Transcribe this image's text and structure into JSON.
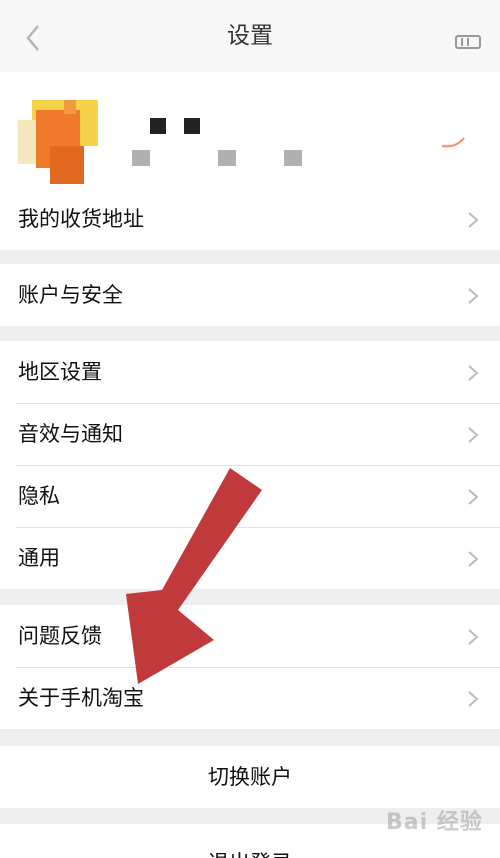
{
  "header": {
    "title": "设置"
  },
  "groups": {
    "address": [
      "我的收货地址"
    ],
    "account": [
      "账户与安全"
    ],
    "prefs": [
      "地区设置",
      "音效与通知",
      "隐私",
      "通用"
    ],
    "about": [
      "问题反馈",
      "关于手机淘宝"
    ]
  },
  "actions": {
    "switch_account": "切换账户",
    "logout": "退出登录"
  },
  "watermark": "Bai 经验",
  "colors": {
    "arrow": "#c0393b",
    "avatar_orange": "#f07a2c",
    "avatar_yellow": "#f5d24a"
  },
  "icons": [
    "back-arrow",
    "more-menu",
    "chevron-right"
  ]
}
